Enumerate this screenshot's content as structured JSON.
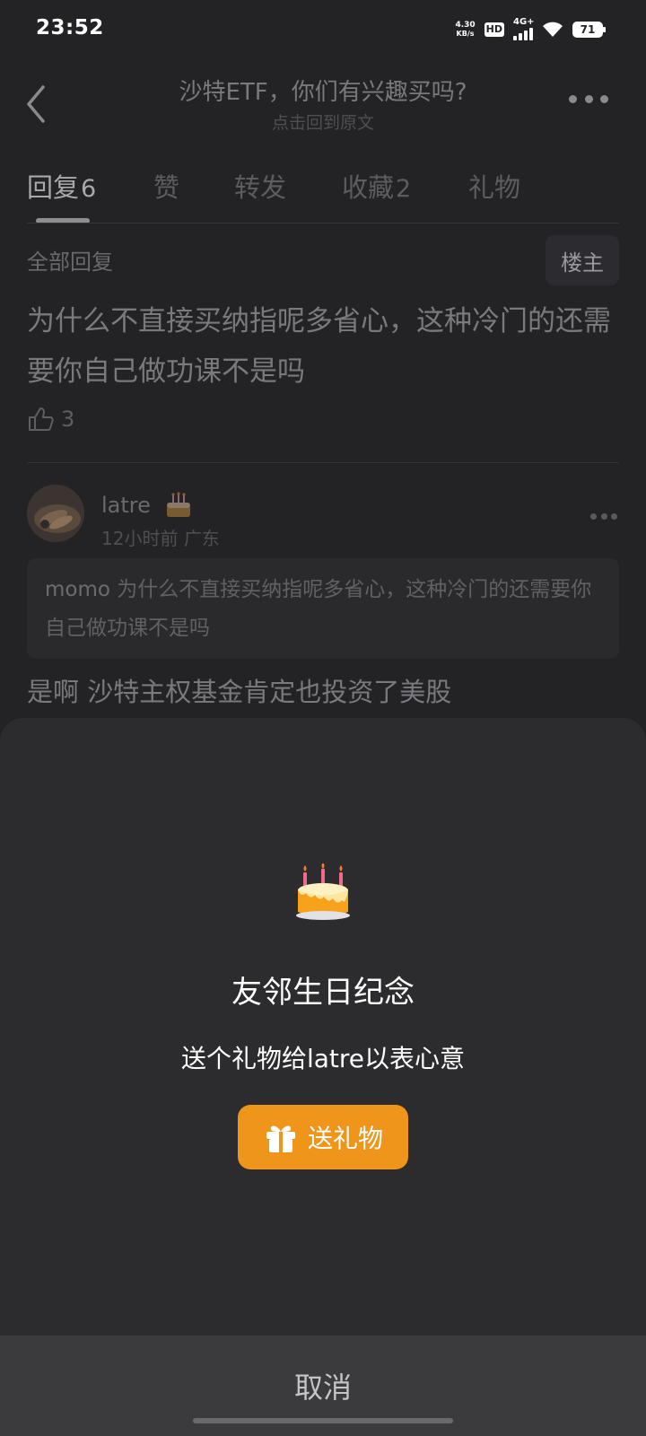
{
  "status": {
    "time": "23:52",
    "net_speed_value": "4.30",
    "net_speed_unit": "KB/s",
    "hd": "HD",
    "network": "4G+",
    "battery": "71"
  },
  "nav": {
    "title": "沙特ETF，你们有兴趣买吗?",
    "subtitle": "点击回到原文"
  },
  "tabs": [
    {
      "label": "回复",
      "count": "6"
    },
    {
      "label": "赞",
      "count": ""
    },
    {
      "label": "转发",
      "count": ""
    },
    {
      "label": "收藏",
      "count": "2"
    },
    {
      "label": "礼物",
      "count": ""
    }
  ],
  "section": {
    "heading": "全部回复",
    "owner_label": "楼主"
  },
  "post": {
    "text": "为什么不直接买纳指呢多省心，这种冷门的还需要你自己做功课不是吗",
    "likes": "3"
  },
  "reply": {
    "username": "latre",
    "time": "12小时前",
    "location": "广东",
    "quote_name": "momo",
    "quote_text": "为什么不直接买纳指呢多省心，这种冷门的还需要你自己做功课不是吗",
    "text": "是啊 沙特主权基金肯定也投资了美股"
  },
  "sheet": {
    "title": "友邻生日纪念",
    "description": "送个礼物给latre以表心意",
    "gift_button": "送礼物",
    "cancel": "取消"
  },
  "colors": {
    "accent": "#ef951a",
    "sheet_bg": "#2c2c2f",
    "page_bg": "#232326"
  }
}
